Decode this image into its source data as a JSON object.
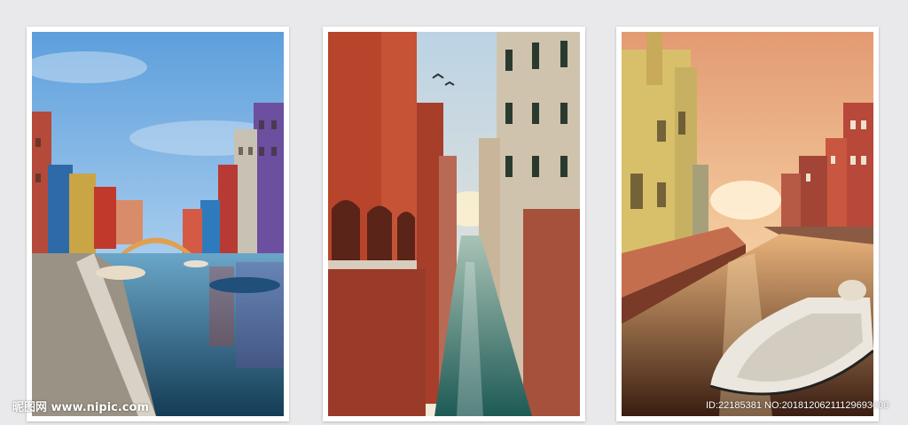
{
  "watermark": {
    "brand_glyphs": "昵图网",
    "site": "www.nipic.com",
    "id_line": "ID:22185381 NO:20181206211129693000"
  },
  "colors": {
    "page_background": "#e9e9ec",
    "frame": "#ffffff"
  },
  "panels": [
    {
      "name": "canal-blue-sky",
      "description_icon": "canal-photo-icon"
    },
    {
      "name": "canal-narrow-brick",
      "description_icon": "canal-photo-icon"
    },
    {
      "name": "canal-sunset",
      "description_icon": "canal-photo-icon"
    }
  ]
}
